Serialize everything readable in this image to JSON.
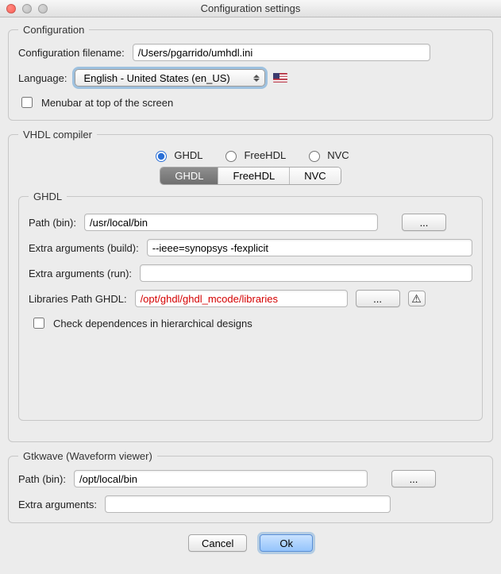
{
  "window": {
    "title": "Configuration settings"
  },
  "configuration": {
    "legend": "Configuration",
    "filename_label": "Configuration filename:",
    "filename_value": "/Users/pgarrido/umhdl.ini",
    "language_label": "Language:",
    "language_value": "English - United States (en_US)",
    "menubar_label": "Menubar at top of the screen"
  },
  "compiler": {
    "legend": "VHDL compiler",
    "options": {
      "ghdl": "GHDL",
      "freehdl": "FreeHDL",
      "nvc": "NVC"
    },
    "selected": "ghdl",
    "tabs": {
      "ghdl": "GHDL",
      "freehdl": "FreeHDL",
      "nvc": "NVC"
    },
    "inner_legend": "GHDL",
    "path_label": "Path (bin):",
    "path_value": "/usr/local/bin",
    "browse_label": "...",
    "extra_build_label": "Extra arguments (build):",
    "extra_build_value": "--ieee=synopsys -fexplicit",
    "extra_run_label": "Extra arguments (run):",
    "extra_run_value": "",
    "libs_label": "Libraries Path GHDL:",
    "libs_value": "/opt/ghdl/ghdl_mcode/libraries",
    "check_deps_label": "Check dependences in hierarchical designs",
    "warning_glyph": "⚠"
  },
  "gtkwave": {
    "legend": "Gtkwave (Waveform viewer)",
    "path_label": "Path (bin):",
    "path_value": "/opt/local/bin",
    "browse_label": "...",
    "extra_label": "Extra arguments:",
    "extra_value": ""
  },
  "footer": {
    "cancel": "Cancel",
    "ok": "Ok"
  }
}
